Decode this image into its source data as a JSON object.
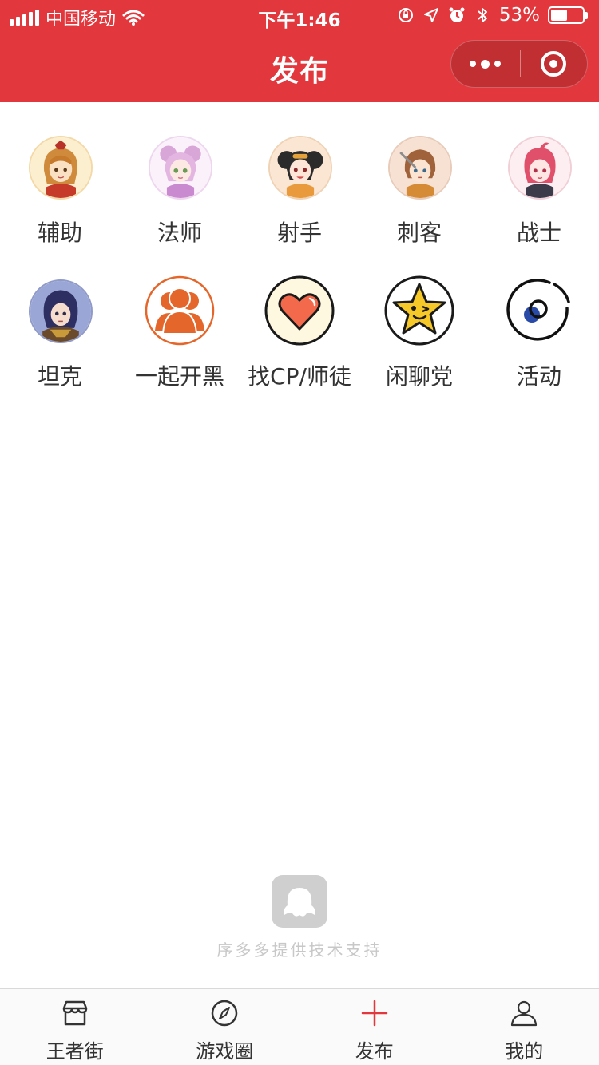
{
  "status_bar": {
    "carrier": "中国移动",
    "time": "下午1:46",
    "battery_percent": "53%",
    "battery_level": 0.53,
    "icons": [
      "signal-icon",
      "wifi-icon",
      "orientation-lock-icon",
      "location-icon",
      "alarm-icon",
      "bluetooth-icon",
      "battery-icon"
    ]
  },
  "nav": {
    "title": "发布",
    "menu_icon": "more-dots-icon",
    "close_icon": "close-target-icon"
  },
  "categories": [
    {
      "label": "辅助",
      "icon": "support-hero-avatar"
    },
    {
      "label": "法师",
      "icon": "mage-hero-avatar"
    },
    {
      "label": "射手",
      "icon": "marksman-hero-avatar"
    },
    {
      "label": "刺客",
      "icon": "assassin-hero-avatar"
    },
    {
      "label": "战士",
      "icon": "warrior-hero-avatar"
    },
    {
      "label": "坦克",
      "icon": "tank-hero-avatar"
    },
    {
      "label": "一起开黑",
      "icon": "team-people-icon"
    },
    {
      "label": "找CP/师徒",
      "icon": "heart-icon"
    },
    {
      "label": "闲聊党",
      "icon": "star-wink-icon"
    },
    {
      "label": "活动",
      "icon": "activity-circle-icon"
    }
  ],
  "footer": {
    "brand_text": "序多多提供技术支持",
    "brand_icon": "octopus-logo-icon"
  },
  "tabbar": [
    {
      "label": "王者街",
      "icon": "shop-icon",
      "active": false
    },
    {
      "label": "游戏圈",
      "icon": "compass-icon",
      "active": false
    },
    {
      "label": "发布",
      "icon": "plus-icon",
      "active": true
    },
    {
      "label": "我的",
      "icon": "user-icon",
      "active": false
    }
  ],
  "colors": {
    "header": "#e2373c",
    "accent": "#e2373c",
    "orange": "#e4662a",
    "star": "#f7c928",
    "heart": "#f26a4b"
  }
}
